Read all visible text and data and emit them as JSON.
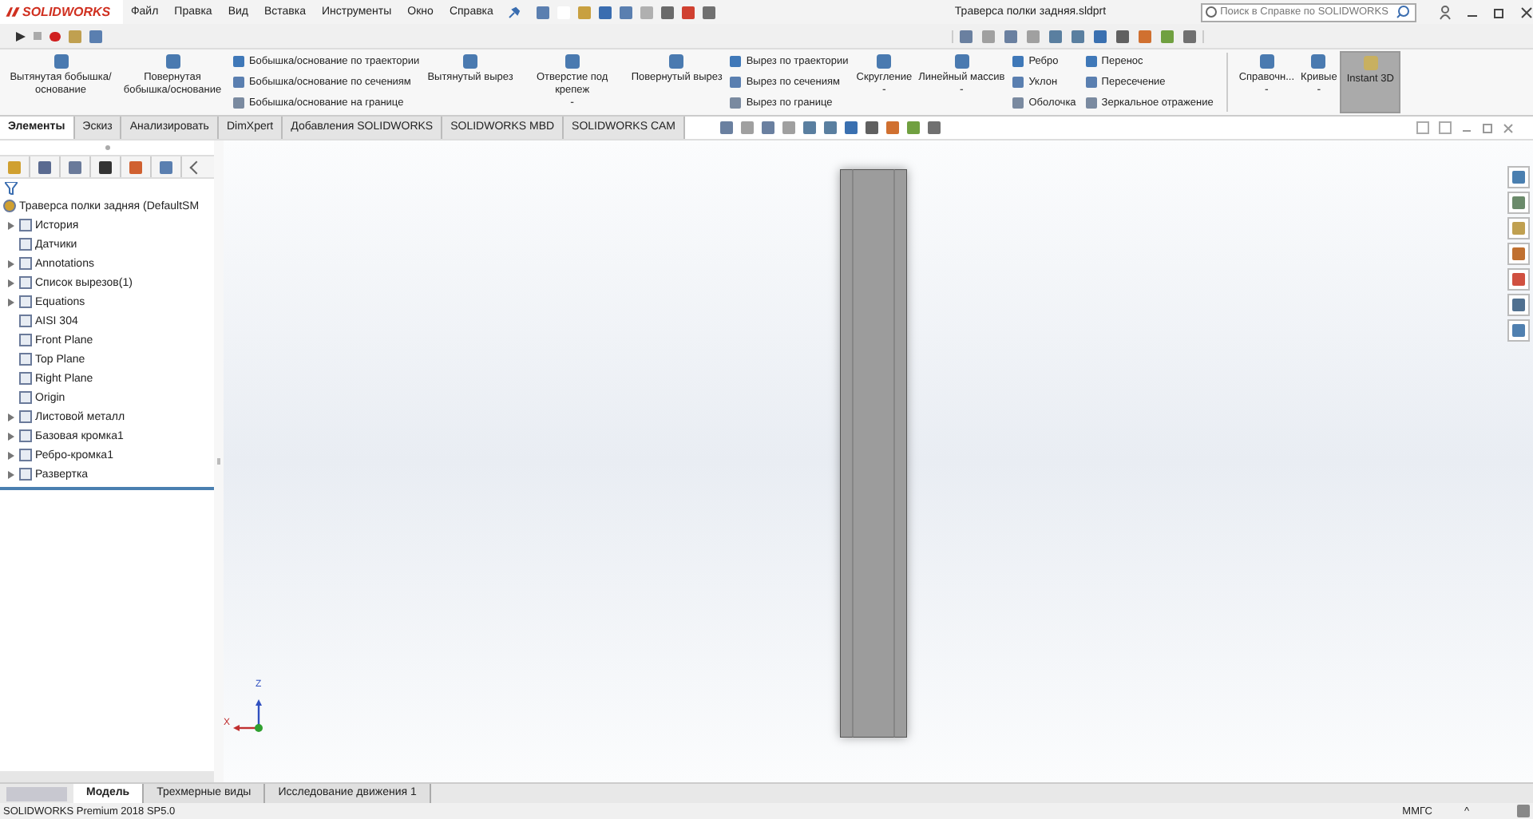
{
  "app": {
    "logo": "SOLIDWORKS"
  },
  "menu": [
    "Файл",
    "Правка",
    "Вид",
    "Вставка",
    "Инструменты",
    "Окно",
    "Справка"
  ],
  "document_title": "Траверса полки задняя.sldprt",
  "search": {
    "placeholder": "Поиск в Справке по SOLIDWORKS"
  },
  "ribbon": [
    {
      "kind": "large",
      "label": "Вытянутая бобышка/основание"
    },
    {
      "kind": "large",
      "label": "Повернутая бобышка/основание"
    },
    {
      "kind": "stack",
      "items": [
        "Бобышка/основание по траектории",
        "Бобышка/основание по сечениям",
        "Бобышка/основание на границе"
      ]
    },
    {
      "kind": "large",
      "label": "Вытянутый вырез"
    },
    {
      "kind": "large",
      "label": "Отверстие под крепеж",
      "dropdown": "-"
    },
    {
      "kind": "large",
      "label": "Повернутый вырез"
    },
    {
      "kind": "stack",
      "items": [
        "Вырез по траектории",
        "Вырез по сечениям",
        "Вырез по границе"
      ]
    },
    {
      "kind": "large",
      "label": "Скругление",
      "dropdown": "-"
    },
    {
      "kind": "large",
      "label": "Линейный массив",
      "dropdown": "-"
    },
    {
      "kind": "stack",
      "items": [
        "Ребро",
        "Уклон",
        "Оболочка"
      ]
    },
    {
      "kind": "stack",
      "items": [
        "Перенос",
        "Пересечение",
        "Зеркальное отражение"
      ]
    },
    {
      "kind": "separator"
    },
    {
      "kind": "large",
      "label": "Справочн...",
      "dropdown": "-"
    },
    {
      "kind": "large",
      "label": "Кривые",
      "dropdown": "-"
    },
    {
      "kind": "toggle",
      "label": "Instant 3D",
      "selected": true
    }
  ],
  "tabs": [
    {
      "label": "Элементы",
      "selected": true
    },
    {
      "label": "Эскиз",
      "selected": false
    },
    {
      "label": "Анализировать",
      "selected": false
    },
    {
      "label": "DimXpert",
      "selected": false
    },
    {
      "label": "Добавления SOLIDWORKS",
      "selected": false
    },
    {
      "label": "SOLIDWORKS MBD",
      "selected": false
    },
    {
      "label": "SOLIDWORKS CAM",
      "selected": false
    }
  ],
  "tree": {
    "label": "Траверса полки задняя  (DefaultSM",
    "children": [
      {
        "label": "История",
        "expandable": true
      },
      {
        "label": "Датчики",
        "expandable": false
      },
      {
        "label": "Annotations",
        "expandable": true
      },
      {
        "label": "Список вырезов(1)",
        "expandable": true
      },
      {
        "label": "Equations",
        "expandable": true
      },
      {
        "label": "AISI 304",
        "expandable": false
      },
      {
        "label": "Front Plane",
        "expandable": false
      },
      {
        "label": "Top Plane",
        "expandable": false
      },
      {
        "label": "Right Plane",
        "expandable": false
      },
      {
        "label": "Origin",
        "expandable": false
      },
      {
        "label": "Листовой металл",
        "expandable": true
      },
      {
        "label": "Базовая кромка1",
        "expandable": true
      },
      {
        "label": "Ребро-кромка1",
        "expandable": true
      },
      {
        "label": "Развертка",
        "expandable": true
      }
    ]
  },
  "triad": {
    "z": "Z",
    "x": "X"
  },
  "bottom_tabs": [
    {
      "label": "Модель",
      "selected": true
    },
    {
      "label": "Трехмерные виды",
      "selected": false
    },
    {
      "label": "Исследование движения 1",
      "selected": false
    }
  ],
  "status_bar": {
    "product": "SOLIDWORKS Premium 2018 SP5.0",
    "units": "ММГС",
    "caret": "^"
  }
}
